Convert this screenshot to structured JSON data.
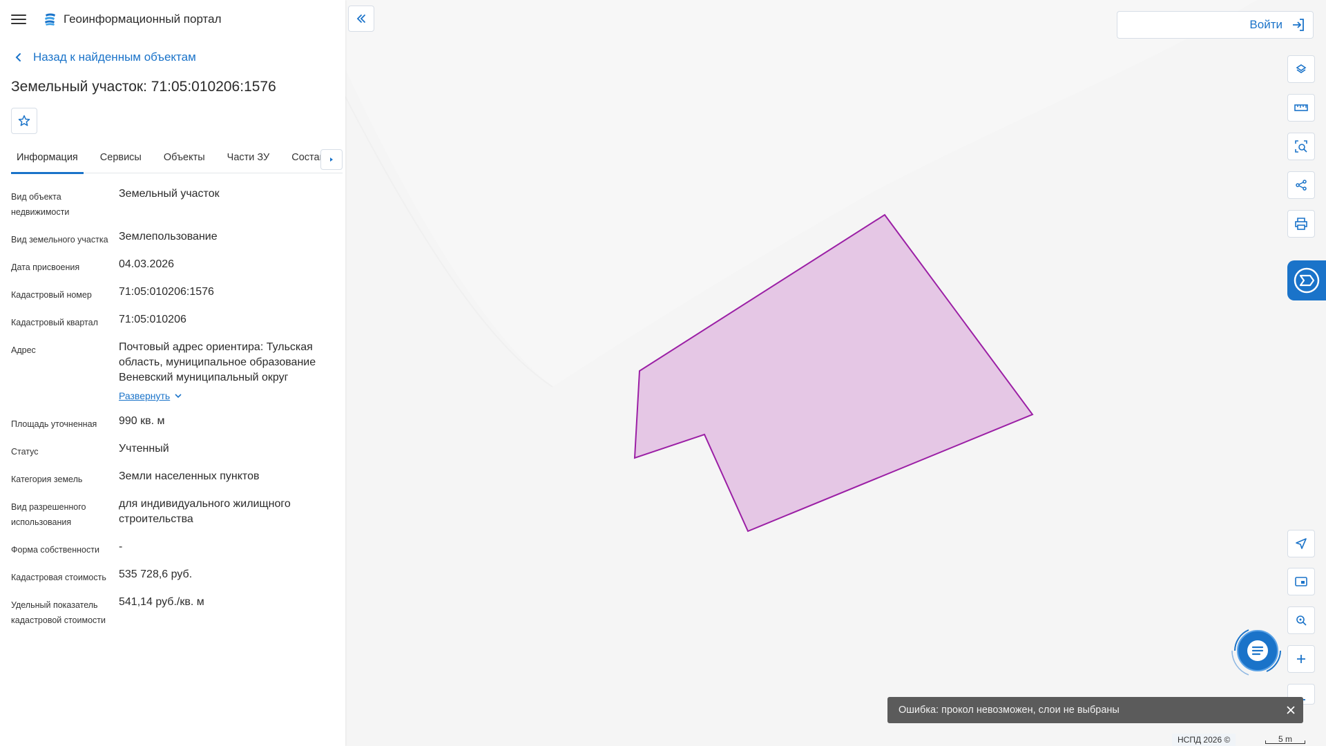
{
  "header": {
    "app_title": "Геоинформационный портал"
  },
  "nav": {
    "back_label": "Назад к найденным объектам"
  },
  "object": {
    "title": "Земельный участок: 71:05:010206:1576"
  },
  "tabs": [
    {
      "label": "Информация",
      "active": true
    },
    {
      "label": "Сервисы"
    },
    {
      "label": "Объекты"
    },
    {
      "label": "Части ЗУ"
    },
    {
      "label": "Состав"
    }
  ],
  "fields": [
    {
      "label": "Вид объекта недвижимости",
      "value": "Земельный участок"
    },
    {
      "label": "Вид земельного участка",
      "value": "Землепользование"
    },
    {
      "label": "Дата присвоения",
      "value": "04.03.2026"
    },
    {
      "label": "Кадастровый номер",
      "value": "71:05:010206:1576"
    },
    {
      "label": "Кадастровый квартал",
      "value": "71:05:010206"
    },
    {
      "label": "Адрес",
      "value": "Почтовый адрес ориентира: Тульская область, муниципальное образование Веневский муниципальный округ",
      "expand_label": "Развернуть"
    },
    {
      "label": "Площадь уточненная",
      "value": "990 кв. м"
    },
    {
      "label": "Статус",
      "value": "Учтенный"
    },
    {
      "label": "Категория земель",
      "value": "Земли населенных пунктов"
    },
    {
      "label": "Вид разрешенного использования",
      "value": "для индивидуального жилищного строительства"
    },
    {
      "label": "Форма собственности",
      "value": "-"
    },
    {
      "label": "Кадастровая стоимость",
      "value": "535 728,6 руб."
    },
    {
      "label": "Удельный показатель кадастровой стоимости",
      "value": "541,14 руб./кв. м"
    }
  ],
  "map": {
    "login_label": "Войти",
    "tools": [
      "layers-icon",
      "ruler-icon",
      "area-search-icon",
      "share-icon",
      "print-icon",
      "navigate-icon",
      "minimap-icon",
      "location-search-icon",
      "zoom-in-icon",
      "zoom-out-icon"
    ],
    "parcel_fill": "#e5c7e5",
    "parcel_stroke": "#9b1fa5",
    "toast": "Ошибка: прокол невозможен, слои не выбраны",
    "attribution": "НСПД 2026 ©",
    "scale_label": "5 m"
  },
  "colors": {
    "accent": "#1a73c9"
  }
}
